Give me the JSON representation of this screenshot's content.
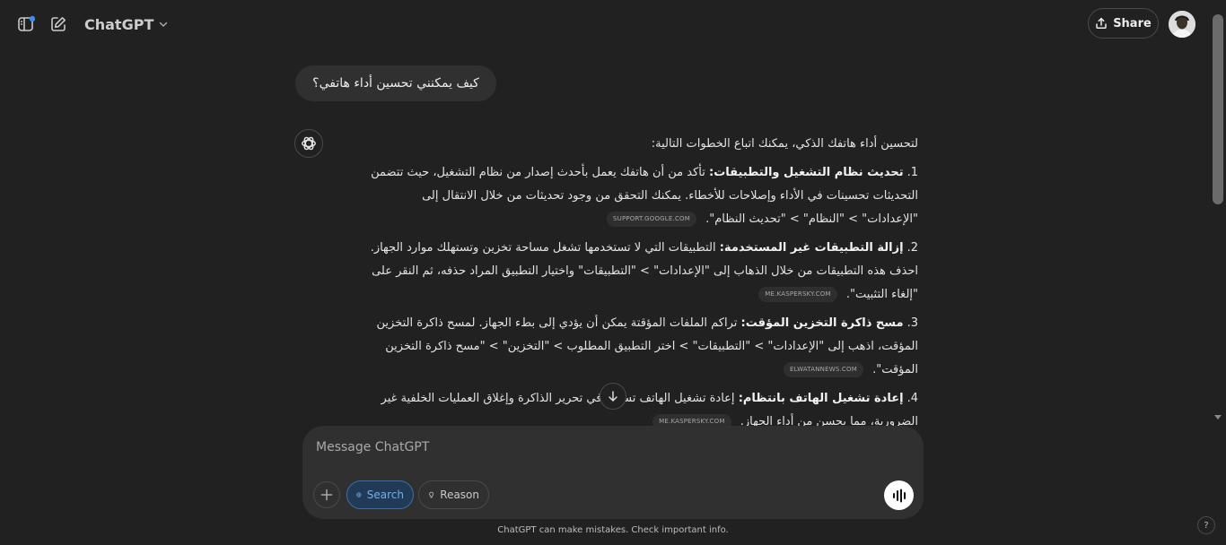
{
  "header": {
    "model_name": "ChatGPT",
    "share_label": "Share"
  },
  "conversation": {
    "user_message": "كيف يمكنني تحسين أداء هاتفي؟",
    "assistant": {
      "intro": "لتحسين أداء هاتفك الذكي، يمكنك اتباع الخطوات التالية:",
      "items": [
        {
          "number": "1.",
          "title": "تحديث نظام التشغيل والتطبيقات:",
          "text": "تأكد من أن هاتفك يعمل بأحدث إصدار من نظام التشغيل، حيث تتضمن التحديثات تحسينات في الأداء وإصلاحات للأخطاء. يمكنك التحقق من وجود تحديثات من خلال الانتقال إلى \"الإعدادات\" > \"النظام\" > \"تحديث النظام\".",
          "source": "SUPPORT.GOOGLE.COM"
        },
        {
          "number": "2.",
          "title": "إزالة التطبيقات غير المستخدمة:",
          "text": "التطبيقات التي لا تستخدمها تشغل مساحة تخزين وتستهلك موارد الجهاز. احذف هذه التطبيقات من خلال الذهاب إلى \"الإعدادات\" > \"التطبيقات\" واختيار التطبيق المراد حذفه، ثم النقر على \"إلغاء التثبيت\".",
          "source": "ME.KASPERSKY.COM"
        },
        {
          "number": "3.",
          "title": "مسح ذاكرة التخزين المؤقت:",
          "text": "تراكم الملفات المؤقتة يمكن أن يؤدي إلى بطء الجهاز. لمسح ذاكرة التخزين المؤقت، اذهب إلى \"الإعدادات\" > \"التطبيقات\" > اختر التطبيق المطلوب > \"التخزين\" > \"مسح ذاكرة التخزين المؤقت\".",
          "source": "ELWATANNEWS.COM"
        },
        {
          "number": "4.",
          "title": "إعادة تشغيل الهاتف بانتظام:",
          "text": "إعادة تشغيل الهاتف تساعد في تحرير الذاكرة وإغلاق العمليات الخلفية غير الضرورية، مما يحسن من أداء الجهاز.",
          "source": "ME.KASPERSKY.COM"
        }
      ]
    }
  },
  "composer": {
    "placeholder": "Message ChatGPT",
    "search_label": "Search",
    "reason_label": "Reason"
  },
  "footer": {
    "disclaimer": "ChatGPT can make mistakes. Check important info.",
    "help_label": "?"
  },
  "colors": {
    "background": "#212121",
    "bubble": "#303030",
    "search_accent": "#72aef0",
    "notification_dot": "#3b8cf0"
  },
  "icons": {
    "sidebar_toggle": "sidebar-icon",
    "new_chat": "new-chat-icon",
    "model_dropdown": "chevron-down-icon",
    "share": "share-icon",
    "assistant": "openai-logo-icon",
    "scroll_down": "arrow-down-icon",
    "attach": "plus-icon",
    "search": "globe-icon",
    "reason": "lightbulb-icon",
    "voice": "voice-wave-icon"
  }
}
